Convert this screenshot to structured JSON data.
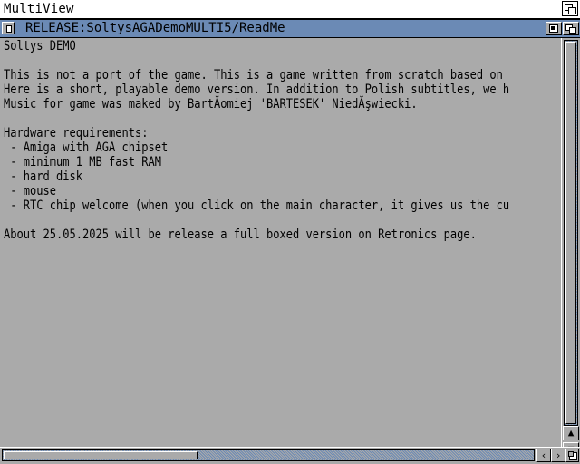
{
  "screen": {
    "title": "MultiView"
  },
  "window": {
    "title": "RELEASE:SoltysAGADemoMULTI5/ReadMe"
  },
  "document": {
    "lines": [
      "Soltys DEMO",
      "",
      "This is not a port of the game. This is a game written from scratch based on",
      "Here is a short, playable demo version. In addition to Polish subtitles, we h",
      "Music for game was maked by BartĂomiej 'BARTESEK' NiedĂşwiecki.",
      "",
      "Hardware requirements:",
      " - Amiga with AGA chipset",
      " - minimum 1 MB fast RAM",
      " - hard disk",
      " - mouse",
      " - RTC chip welcome (when you click on the main character, it gives us the cu",
      "",
      "About 25.05.2025 will be release a full boxed version on Retronics page."
    ]
  },
  "scrollbar": {
    "up_arrow": "▲",
    "down_arrow": "▼",
    "left_arrow": "‹",
    "right_arrow": "›"
  },
  "colors": {
    "background": "#aaaaaa",
    "title_bar": "#6b8ab5",
    "screen_bar": "#ffffff"
  }
}
